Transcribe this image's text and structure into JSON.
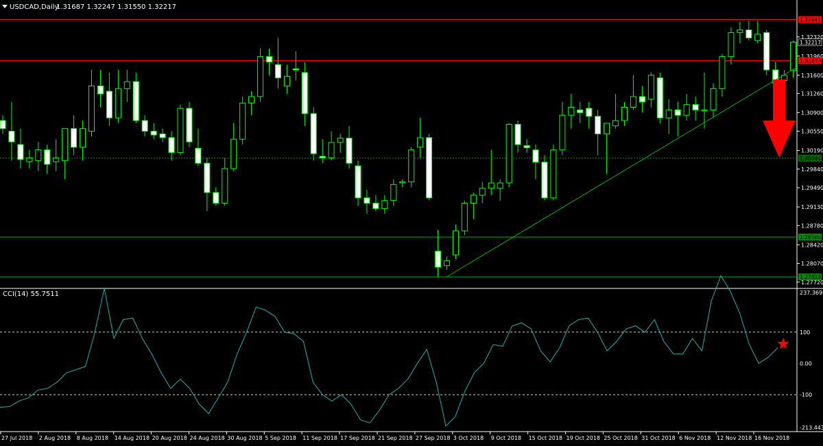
{
  "header": {
    "symbol": "USDCAD,Daily",
    "ohlc": "1.31687 1.32247 1.31550 1.32217"
  },
  "cci_header": "CCI(14) 55.7511",
  "colors": {
    "background": "#000000",
    "candle": "#00ff00",
    "bull_fill": "#000000",
    "bear_fill": "#ffffff",
    "resistance": "#ff0000",
    "support": "#00aa00",
    "trendline": "#00b000",
    "dotted": "#00a000",
    "cci_line": "#20b2aa",
    "axis_text": "#ffffff",
    "arrow": "#ff0000",
    "star": "#ff0000"
  },
  "price_axis": {
    "ticks": [
      "1.32320",
      "1.31960",
      "1.31600",
      "1.31260",
      "1.30900",
      "1.30550",
      "1.30190",
      "1.29840",
      "1.29490",
      "1.29130",
      "1.28780",
      "1.28420",
      "1.28070",
      "1.27720"
    ],
    "tags": [
      {
        "text": "1.32645",
        "type": "resistance"
      },
      {
        "text": "1.32217",
        "type": "current"
      },
      {
        "text": "1.31874",
        "type": "resistance"
      },
      {
        "text": "1.30044",
        "type": "dotted"
      },
      {
        "text": "1.28566",
        "type": "support"
      },
      {
        "text": "1.27818",
        "type": "support"
      }
    ]
  },
  "cci_axis": {
    "ticks": [
      "237.3698",
      "100",
      "0.00",
      "-100",
      "-213.4432"
    ]
  },
  "date_axis": {
    "labels": [
      "27 Jul 2018",
      "2 Aug 2018",
      "8 Aug 2018",
      "14 Aug 2018",
      "20 Aug 2018",
      "24 Aug 2018",
      "30 Aug 2018",
      "5 Sep 2018",
      "11 Sep 2018",
      "17 Sep 2018",
      "21 Sep 2018",
      "27 Sep 2018",
      "3 Oct 2018",
      "9 Oct 2018",
      "15 Oct 2018",
      "19 Oct 2018",
      "25 Oct 2018",
      "31 Oct 2018",
      "6 Nov 2018",
      "12 Nov 2018",
      "16 Nov 2018"
    ]
  },
  "chart_data": [
    {
      "type": "candlestick",
      "title": "USDCAD,Daily",
      "ylim": [
        1.2764,
        1.3296
      ],
      "horizontal_levels": [
        {
          "value": 1.32645,
          "style": "resistance"
        },
        {
          "value": 1.31874,
          "style": "resistance"
        },
        {
          "value": 1.30044,
          "style": "dotted"
        },
        {
          "value": 1.28566,
          "style": "support"
        },
        {
          "value": 1.27818,
          "style": "support"
        }
      ],
      "trendline": {
        "from": {
          "bar": 50,
          "value": 1.2782
        },
        "to": {
          "bar": 97,
          "value": 1.3251
        }
      },
      "candles": [
        {
          "o": 1.3075,
          "h": 1.3085,
          "l": 1.305,
          "c": 1.306
        },
        {
          "o": 1.3055,
          "h": 1.311,
          "l": 1.3,
          "c": 1.3035
        },
        {
          "o": 1.303,
          "h": 1.306,
          "l": 1.2985,
          "c": 1.3002
        },
        {
          "o": 1.2998,
          "h": 1.302,
          "l": 1.2985,
          "c": 1.3005
        },
        {
          "o": 1.3,
          "h": 1.3035,
          "l": 1.298,
          "c": 1.302
        },
        {
          "o": 1.302,
          "h": 1.303,
          "l": 1.2975,
          "c": 1.2993
        },
        {
          "o": 1.2998,
          "h": 1.304,
          "l": 1.298,
          "c": 1.3005
        },
        {
          "o": 1.3,
          "h": 1.306,
          "l": 1.2965,
          "c": 1.306
        },
        {
          "o": 1.306,
          "h": 1.3085,
          "l": 1.301,
          "c": 1.3025
        },
        {
          "o": 1.3025,
          "h": 1.3075,
          "l": 1.3,
          "c": 1.306
        },
        {
          "o": 1.3055,
          "h": 1.317,
          "l": 1.3045,
          "c": 1.314
        },
        {
          "o": 1.314,
          "h": 1.317,
          "l": 1.31,
          "c": 1.3125
        },
        {
          "o": 1.313,
          "h": 1.3165,
          "l": 1.3065,
          "c": 1.308
        },
        {
          "o": 1.308,
          "h": 1.317,
          "l": 1.307,
          "c": 1.3135
        },
        {
          "o": 1.3135,
          "h": 1.317,
          "l": 1.311,
          "c": 1.3148
        },
        {
          "o": 1.3148,
          "h": 1.3165,
          "l": 1.307,
          "c": 1.3075
        },
        {
          "o": 1.3075,
          "h": 1.3085,
          "l": 1.3045,
          "c": 1.3055
        },
        {
          "o": 1.3055,
          "h": 1.307,
          "l": 1.304,
          "c": 1.3048
        },
        {
          "o": 1.305,
          "h": 1.306,
          "l": 1.3035,
          "c": 1.3043
        },
        {
          "o": 1.3043,
          "h": 1.3055,
          "l": 1.3,
          "c": 1.3015
        },
        {
          "o": 1.3015,
          "h": 1.3105,
          "l": 1.301,
          "c": 1.3098
        },
        {
          "o": 1.3098,
          "h": 1.311,
          "l": 1.3025,
          "c": 1.3035
        },
        {
          "o": 1.3023,
          "h": 1.306,
          "l": 1.299,
          "c": 1.2995
        },
        {
          "o": 1.2995,
          "h": 1.3005,
          "l": 1.2905,
          "c": 1.294
        },
        {
          "o": 1.294,
          "h": 1.295,
          "l": 1.2915,
          "c": 1.292
        },
        {
          "o": 1.292,
          "h": 1.3005,
          "l": 1.2915,
          "c": 1.2985
        },
        {
          "o": 1.2985,
          "h": 1.307,
          "l": 1.298,
          "c": 1.304
        },
        {
          "o": 1.304,
          "h": 1.312,
          "l": 1.303,
          "c": 1.3108
        },
        {
          "o": 1.3108,
          "h": 1.313,
          "l": 1.3085,
          "c": 1.312
        },
        {
          "o": 1.312,
          "h": 1.321,
          "l": 1.311,
          "c": 1.3195
        },
        {
          "o": 1.3195,
          "h": 1.321,
          "l": 1.316,
          "c": 1.3185
        },
        {
          "o": 1.318,
          "h": 1.323,
          "l": 1.3135,
          "c": 1.3155
        },
        {
          "o": 1.314,
          "h": 1.318,
          "l": 1.3125,
          "c": 1.3158
        },
        {
          "o": 1.3172,
          "h": 1.3205,
          "l": 1.315,
          "c": 1.317
        },
        {
          "o": 1.3165,
          "h": 1.3185,
          "l": 1.3065,
          "c": 1.3088
        },
        {
          "o": 1.3088,
          "h": 1.31,
          "l": 1.3,
          "c": 1.3013
        },
        {
          "o": 1.3008,
          "h": 1.304,
          "l": 1.2995,
          "c": 1.3005
        },
        {
          "o": 1.3005,
          "h": 1.3055,
          "l": 1.3,
          "c": 1.3034
        },
        {
          "o": 1.3034,
          "h": 1.305,
          "l": 1.3015,
          "c": 1.3042
        },
        {
          "o": 1.3042,
          "h": 1.3065,
          "l": 1.2985,
          "c": 1.2995
        },
        {
          "o": 1.299,
          "h": 1.3,
          "l": 1.2915,
          "c": 1.293
        },
        {
          "o": 1.293,
          "h": 1.2945,
          "l": 1.29,
          "c": 1.292
        },
        {
          "o": 1.292,
          "h": 1.2935,
          "l": 1.2905,
          "c": 1.291
        },
        {
          "o": 1.291,
          "h": 1.2935,
          "l": 1.29,
          "c": 1.2925
        },
        {
          "o": 1.2925,
          "h": 1.2965,
          "l": 1.2915,
          "c": 1.2955
        },
        {
          "o": 1.296,
          "h": 1.2965,
          "l": 1.295,
          "c": 1.296
        },
        {
          "o": 1.296,
          "h": 1.3025,
          "l": 1.295,
          "c": 1.302
        },
        {
          "o": 1.3025,
          "h": 1.308,
          "l": 1.3005,
          "c": 1.3043
        },
        {
          "o": 1.3043,
          "h": 1.305,
          "l": 1.2925,
          "c": 1.293
        },
        {
          "o": 1.283,
          "h": 1.287,
          "l": 1.2782,
          "c": 1.28
        },
        {
          "o": 1.2803,
          "h": 1.282,
          "l": 1.2795,
          "c": 1.2812
        },
        {
          "o": 1.2823,
          "h": 1.288,
          "l": 1.2815,
          "c": 1.2868
        },
        {
          "o": 1.2868,
          "h": 1.2925,
          "l": 1.286,
          "c": 1.292
        },
        {
          "o": 1.292,
          "h": 1.294,
          "l": 1.289,
          "c": 1.2935
        },
        {
          "o": 1.2935,
          "h": 1.296,
          "l": 1.292,
          "c": 1.2948
        },
        {
          "o": 1.2948,
          "h": 1.302,
          "l": 1.2935,
          "c": 1.2958
        },
        {
          "o": 1.2948,
          "h": 1.2965,
          "l": 1.2925,
          "c": 1.2958
        },
        {
          "o": 1.2958,
          "h": 1.307,
          "l": 1.295,
          "c": 1.3068
        },
        {
          "o": 1.3068,
          "h": 1.3075,
          "l": 1.3015,
          "c": 1.303
        },
        {
          "o": 1.3028,
          "h": 1.304,
          "l": 1.3015,
          "c": 1.3024
        },
        {
          "o": 1.302,
          "h": 1.303,
          "l": 1.2965,
          "c": 1.2997
        },
        {
          "o": 1.2997,
          "h": 1.301,
          "l": 1.2925,
          "c": 1.293
        },
        {
          "o": 1.293,
          "h": 1.303,
          "l": 1.2925,
          "c": 1.302
        },
        {
          "o": 1.302,
          "h": 1.311,
          "l": 1.301,
          "c": 1.3085
        },
        {
          "o": 1.3085,
          "h": 1.3125,
          "l": 1.306,
          "c": 1.31
        },
        {
          "o": 1.3095,
          "h": 1.311,
          "l": 1.307,
          "c": 1.309
        },
        {
          "o": 1.3098,
          "h": 1.311,
          "l": 1.306,
          "c": 1.3083
        },
        {
          "o": 1.3083,
          "h": 1.3095,
          "l": 1.301,
          "c": 1.305
        },
        {
          "o": 1.305,
          "h": 1.307,
          "l": 1.2975,
          "c": 1.307
        },
        {
          "o": 1.3065,
          "h": 1.3125,
          "l": 1.306,
          "c": 1.3075
        },
        {
          "o": 1.3075,
          "h": 1.311,
          "l": 1.3065,
          "c": 1.31
        },
        {
          "o": 1.31,
          "h": 1.316,
          "l": 1.3095,
          "c": 1.312
        },
        {
          "o": 1.312,
          "h": 1.314,
          "l": 1.309,
          "c": 1.311
        },
        {
          "o": 1.3115,
          "h": 1.3165,
          "l": 1.31,
          "c": 1.316
        },
        {
          "o": 1.3155,
          "h": 1.3165,
          "l": 1.307,
          "c": 1.308
        },
        {
          "o": 1.308,
          "h": 1.3115,
          "l": 1.305,
          "c": 1.3095
        },
        {
          "o": 1.3095,
          "h": 1.311,
          "l": 1.3045,
          "c": 1.3085
        },
        {
          "o": 1.3085,
          "h": 1.3125,
          "l": 1.3075,
          "c": 1.3105
        },
        {
          "o": 1.3105,
          "h": 1.312,
          "l": 1.3075,
          "c": 1.3095
        },
        {
          "o": 1.3095,
          "h": 1.3165,
          "l": 1.306,
          "c": 1.3095
        },
        {
          "o": 1.3095,
          "h": 1.3145,
          "l": 1.308,
          "c": 1.3135
        },
        {
          "o": 1.3135,
          "h": 1.32,
          "l": 1.312,
          "c": 1.3195
        },
        {
          "o": 1.3195,
          "h": 1.325,
          "l": 1.318,
          "c": 1.324
        },
        {
          "o": 1.324,
          "h": 1.326,
          "l": 1.322,
          "c": 1.3245
        },
        {
          "o": 1.3245,
          "h": 1.3262,
          "l": 1.3225,
          "c": 1.323
        },
        {
          "o": 1.3225,
          "h": 1.3262,
          "l": 1.322,
          "c": 1.3237
        },
        {
          "o": 1.324,
          "h": 1.3245,
          "l": 1.316,
          "c": 1.317
        },
        {
          "o": 1.317,
          "h": 1.3185,
          "l": 1.313,
          "c": 1.3145
        },
        {
          "o": 1.315,
          "h": 1.317,
          "l": 1.3138,
          "c": 1.316
        },
        {
          "o": 1.3169,
          "h": 1.3225,
          "l": 1.3155,
          "c": 1.3222
        }
      ]
    },
    {
      "type": "line",
      "title": "CCI(14) 55.7511",
      "ylim": [
        -213.4432,
        237.3698
      ],
      "reference_lines": [
        100,
        -100
      ],
      "series": [
        {
          "values": [
            -140,
            -138,
            -120,
            -110,
            -85,
            -80,
            -60,
            -30,
            -20,
            -10,
            100,
            240,
            80,
            140,
            145,
            80,
            30,
            -30,
            -80,
            -50,
            -80,
            -130,
            -160,
            -110,
            -60,
            30,
            100,
            180,
            170,
            150,
            100,
            95,
            70,
            -60,
            -100,
            -120,
            -100,
            -130,
            -180,
            -190,
            -150,
            -100,
            -80,
            -50,
            0,
            45,
            -60,
            -200,
            -170,
            -90,
            -30,
            0,
            60,
            55,
            120,
            130,
            110,
            40,
            5,
            50,
            120,
            140,
            145,
            100,
            40,
            70,
            110,
            120,
            100,
            140,
            70,
            30,
            30,
            80,
            40,
            200,
            280,
            230,
            160,
            60,
            0,
            20,
            50
          ]
        }
      ]
    }
  ]
}
